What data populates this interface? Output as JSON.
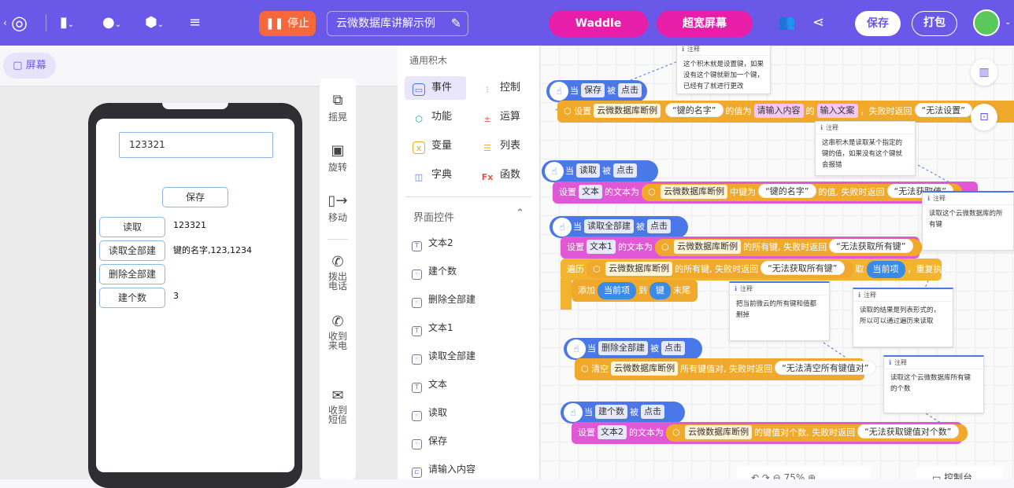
{
  "topbar": {
    "stop_label": "停止",
    "project_name": "云微数据库讲解示例",
    "waddle_label": "Waddle",
    "widescreen_label": "超宽屏幕",
    "save_label": "保存",
    "pack_label": "打包",
    "accent": "#6a59e8"
  },
  "left": {
    "screen_tab": "屏幕",
    "phone": {
      "input_value": "123321",
      "save_btn": "保存",
      "read_btn": "读取",
      "read_value": "123321",
      "read_all_btn": "读取全部建",
      "read_all_value": "键的名字,123,1234",
      "delete_all_btn": "删除全部建",
      "count_btn": "建个数",
      "count_value": "3"
    },
    "tools": [
      "摇晃",
      "旋转",
      "移动",
      "拨出\n电话",
      "收到\n来电",
      "收到\n短信"
    ]
  },
  "palette": {
    "title": "通用积木",
    "categories": [
      {
        "label": "事件",
        "icon": "event-icon"
      },
      {
        "label": "控制",
        "icon": "control-icon"
      },
      {
        "label": "功能",
        "icon": "function-icon"
      },
      {
        "label": "运算",
        "icon": "operator-icon"
      },
      {
        "label": "变量",
        "icon": "variable-icon"
      },
      {
        "label": "列表",
        "icon": "list-icon"
      },
      {
        "label": "字典",
        "icon": "dict-icon"
      },
      {
        "label": "函数",
        "icon": "fx-icon"
      }
    ],
    "section_title": "界面控件",
    "components": [
      "文本2",
      "建个数",
      "删除全部建",
      "文本1",
      "读取全部建",
      "文本",
      "读取",
      "保存",
      "请输入内容"
    ]
  },
  "workspace": {
    "zoom": "75%",
    "console_label": "控制台",
    "note_header": "注释",
    "notes": [
      "这个积木就是设置键，如果没有这个键就新加一个键，已经有了就进行更改",
      "这串积木是读取某个指定的键的值，如果没有这个键就会报错",
      "读取这个云微数据库的所有键",
      "把当前微云的所有键和值都删掉",
      "读取的结果是列表形式的，所以可以通过遍历来读取",
      "读取这个云微数据库所有键的个数"
    ],
    "blocks": {
      "when": "当",
      "clicked": "被",
      "click": "点击",
      "set": "设置",
      "db": "云微数据库断例",
      "key_name": "“键的名字”",
      "value_of": "的值为",
      "input_content": "请输入内容",
      "of": "的",
      "input_text": "输入文案",
      "fail_return": "，失败时返回",
      "cannot_set": "“无法设置”",
      "read": "读取",
      "text": "文本",
      "text_to": "的文本为",
      "in_key": "中键为",
      "value_fail": "的值, 失败时返回",
      "cannot_get_value": "“无法获取值”",
      "read_all": "读取全部建",
      "text1": "文本1",
      "all_keys_fail": "的所有键, 失败时返回",
      "cannot_get_all": "“无法获取所有键”",
      "traverse": "遍历",
      "take": "取",
      "current_item": "当前项",
      "repeat": "，重复执行",
      "add": "添加",
      "to": "到",
      "key": "键",
      "end": "末尾",
      "delete_all": "删除全部建",
      "clear": "清空",
      "all_pairs_fail": "所有键值对, 失败时返回",
      "cannot_clear": "“无法清空所有键值对”",
      "count": "建个数",
      "text2": "文本2",
      "pair_count_fail": "的键值对个数, 失败时返回",
      "cannot_get_count": "“无法获取键值对个数”"
    }
  }
}
